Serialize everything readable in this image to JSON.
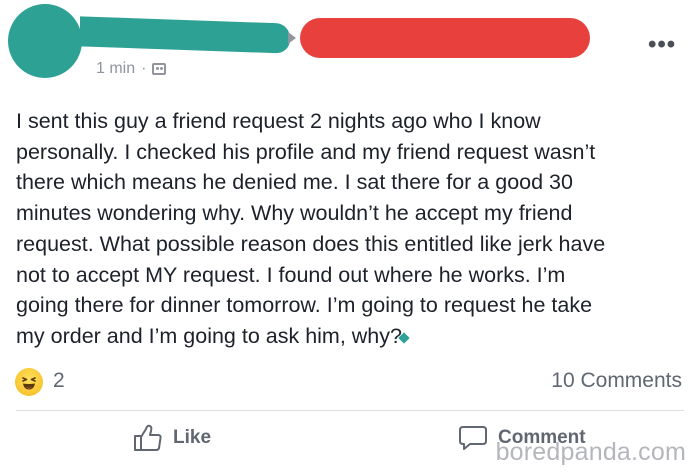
{
  "header": {
    "timestamp": "1 min",
    "separator": "·",
    "audience_icon": "friends-icon",
    "more_icon": "more-options-icon",
    "avatar_redaction_color": "#2ea195",
    "name_redaction_color": "#2ea195",
    "target_redaction_color": "#e8403d"
  },
  "post": {
    "text": "I sent this guy a friend request 2 nights ago who I know\npersonally. I checked his profile and my friend request wasn’t\nthere which means he denied me. I sat there for a good 30\nminutes wondering why. Why wouldn’t he accept my friend\nrequest. What possible reason does this entitled like jerk have\nnot to accept MY request. I found out where he works. I’m\ngoing there for dinner tomorrow. I’m going to request he take\nmy order and I’m going to ask him, why?"
  },
  "stats": {
    "reaction_icon": "haha-reaction-icon",
    "reaction_count": "2",
    "comments": "10 Comments"
  },
  "actions": {
    "like_label": "Like",
    "comment_label": "Comment"
  },
  "watermark": "boredpanda.com"
}
